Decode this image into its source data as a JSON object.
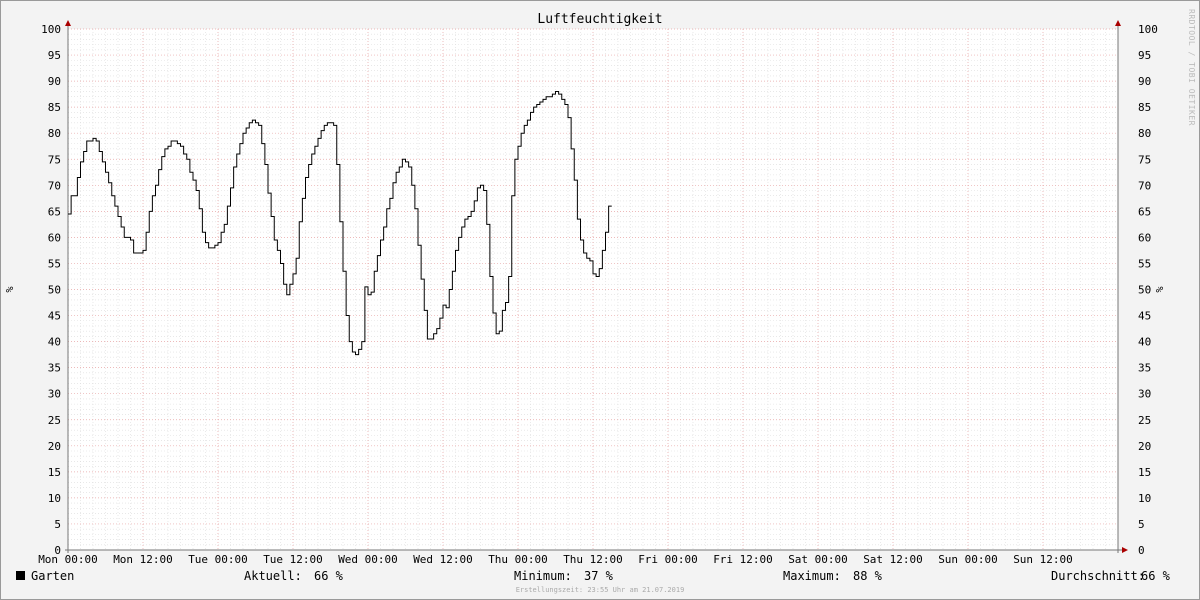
{
  "chart_data": {
    "type": "line",
    "title": "Luftfeuchtigkeit",
    "ylabel": "%",
    "ylim": [
      0,
      100
    ],
    "yticks": [
      0,
      5,
      10,
      15,
      20,
      25,
      30,
      35,
      40,
      45,
      50,
      55,
      60,
      65,
      70,
      75,
      80,
      85,
      90,
      95,
      100
    ],
    "x_ticks": [
      {
        "hour": 0,
        "label": "Mon 00:00"
      },
      {
        "hour": 12,
        "label": "Mon 12:00"
      },
      {
        "hour": 24,
        "label": "Tue 00:00"
      },
      {
        "hour": 36,
        "label": "Tue 12:00"
      },
      {
        "hour": 48,
        "label": "Wed 00:00"
      },
      {
        "hour": 60,
        "label": "Wed 12:00"
      },
      {
        "hour": 72,
        "label": "Thu 00:00"
      },
      {
        "hour": 84,
        "label": "Thu 12:00"
      },
      {
        "hour": 96,
        "label": "Fri 00:00"
      },
      {
        "hour": 108,
        "label": "Fri 12:00"
      },
      {
        "hour": 120,
        "label": "Sat 00:00"
      },
      {
        "hour": 132,
        "label": "Sat 12:00"
      },
      {
        "hour": 144,
        "label": "Sun 00:00"
      },
      {
        "hour": 156,
        "label": "Sun 12:00"
      }
    ],
    "xlim_hours": [
      0,
      168
    ],
    "grid": true,
    "series": [
      {
        "name": "Garten",
        "color": "#000000",
        "points": [
          [
            0,
            64.5
          ],
          [
            0.5,
            68
          ],
          [
            1.5,
            71.5
          ],
          [
            2,
            74.5
          ],
          [
            2.5,
            76.5
          ],
          [
            3,
            78.5
          ],
          [
            4,
            79
          ],
          [
            4.5,
            78.5
          ],
          [
            5,
            76.5
          ],
          [
            5.5,
            74.5
          ],
          [
            6,
            72.5
          ],
          [
            6.5,
            70.5
          ],
          [
            7,
            68
          ],
          [
            7.5,
            66
          ],
          [
            8,
            64
          ],
          [
            8.5,
            62
          ],
          [
            9,
            60
          ],
          [
            10,
            59.5
          ],
          [
            10.5,
            57
          ],
          [
            12,
            57.5
          ],
          [
            12.5,
            61
          ],
          [
            13,
            65
          ],
          [
            13.5,
            68
          ],
          [
            14,
            70
          ],
          [
            14.5,
            73
          ],
          [
            15,
            75.5
          ],
          [
            15.5,
            77
          ],
          [
            16,
            77.5
          ],
          [
            16.5,
            78.5
          ],
          [
            17.5,
            78
          ],
          [
            18,
            77.5
          ],
          [
            18.5,
            76
          ],
          [
            19,
            75
          ],
          [
            19.5,
            72.5
          ],
          [
            20,
            71
          ],
          [
            20.5,
            69
          ],
          [
            21,
            65.5
          ],
          [
            21.5,
            61
          ],
          [
            22,
            59
          ],
          [
            22.5,
            58
          ],
          [
            23.5,
            58.5
          ],
          [
            24,
            59
          ],
          [
            24.5,
            61
          ],
          [
            25,
            62.5
          ],
          [
            25.5,
            66
          ],
          [
            26,
            69.5
          ],
          [
            26.5,
            73.5
          ],
          [
            27,
            76
          ],
          [
            27.5,
            78
          ],
          [
            28,
            80
          ],
          [
            28.5,
            81
          ],
          [
            29,
            82
          ],
          [
            29.5,
            82.5
          ],
          [
            30,
            82
          ],
          [
            30.5,
            81.5
          ],
          [
            31,
            78
          ],
          [
            31.5,
            74
          ],
          [
            32,
            68.5
          ],
          [
            32.5,
            64
          ],
          [
            33,
            59.5
          ],
          [
            33.5,
            57.5
          ],
          [
            34,
            55
          ],
          [
            34.5,
            51
          ],
          [
            35,
            49
          ],
          [
            35.5,
            51
          ],
          [
            36,
            53
          ],
          [
            36.5,
            56
          ],
          [
            37,
            63
          ],
          [
            37.5,
            67.5
          ],
          [
            38,
            71.5
          ],
          [
            38.5,
            74
          ],
          [
            39,
            76
          ],
          [
            39.5,
            77.5
          ],
          [
            40,
            79
          ],
          [
            40.5,
            80.5
          ],
          [
            41,
            81.5
          ],
          [
            41.5,
            82
          ],
          [
            42.5,
            81.5
          ],
          [
            43,
            74
          ],
          [
            43.5,
            63
          ],
          [
            44,
            53.5
          ],
          [
            44.5,
            45
          ],
          [
            45,
            40
          ],
          [
            45.5,
            38
          ],
          [
            46,
            37.5
          ],
          [
            46.5,
            38.5
          ],
          [
            47,
            40
          ],
          [
            47.5,
            50.5
          ],
          [
            48,
            49
          ],
          [
            48.5,
            49.5
          ],
          [
            49,
            53.5
          ],
          [
            49.5,
            56.5
          ],
          [
            50,
            59.5
          ],
          [
            50.5,
            62
          ],
          [
            51,
            65.5
          ],
          [
            51.5,
            67.5
          ],
          [
            52,
            70.5
          ],
          [
            52.5,
            72.5
          ],
          [
            53,
            73.5
          ],
          [
            53.5,
            75
          ],
          [
            54,
            74.5
          ],
          [
            54.5,
            73.5
          ],
          [
            55,
            70
          ],
          [
            55.5,
            65.5
          ],
          [
            56,
            58.5
          ],
          [
            56.5,
            52
          ],
          [
            57,
            46
          ],
          [
            57.5,
            40.5
          ],
          [
            58.5,
            41.5
          ],
          [
            59,
            42.5
          ],
          [
            59.5,
            44.5
          ],
          [
            60,
            47
          ],
          [
            60.5,
            46.5
          ],
          [
            61,
            50
          ],
          [
            61.5,
            53.5
          ],
          [
            62,
            57.5
          ],
          [
            62.5,
            60
          ],
          [
            63,
            62
          ],
          [
            63.5,
            63.5
          ],
          [
            64,
            64
          ],
          [
            64.5,
            65
          ],
          [
            65,
            67
          ],
          [
            65.5,
            69.5
          ],
          [
            66,
            70
          ],
          [
            66.5,
            69
          ],
          [
            67,
            62.5
          ],
          [
            67.5,
            52.5
          ],
          [
            68,
            45.5
          ],
          [
            68.5,
            41.5
          ],
          [
            69,
            42
          ],
          [
            69.5,
            46
          ],
          [
            70,
            47.5
          ],
          [
            70.5,
            52.5
          ],
          [
            71,
            68
          ],
          [
            71.5,
            75
          ],
          [
            72,
            77.5
          ],
          [
            72.5,
            80
          ],
          [
            73,
            81.5
          ],
          [
            73.5,
            82.5
          ],
          [
            74,
            84
          ],
          [
            74.5,
            85
          ],
          [
            75,
            85.5
          ],
          [
            75.5,
            86
          ],
          [
            76,
            86.5
          ],
          [
            76.5,
            87
          ],
          [
            77.5,
            87.5
          ],
          [
            78,
            88
          ],
          [
            78.5,
            87.5
          ],
          [
            79,
            86.5
          ],
          [
            79.5,
            85.5
          ],
          [
            80,
            83
          ],
          [
            80.5,
            77
          ],
          [
            81,
            71
          ],
          [
            81.5,
            63.5
          ],
          [
            82,
            59.5
          ],
          [
            82.5,
            57
          ],
          [
            83,
            56
          ],
          [
            83.5,
            55.5
          ],
          [
            84,
            53
          ],
          [
            84.5,
            52.5
          ],
          [
            85,
            54
          ],
          [
            85.5,
            57.5
          ],
          [
            86,
            61
          ],
          [
            86.5,
            66
          ]
        ]
      }
    ],
    "legend": {
      "series_label": "Garten",
      "stats": [
        {
          "label": "Aktuell:",
          "value": "66 %"
        },
        {
          "label": "Minimum:",
          "value": "37 %"
        },
        {
          "label": "Maximum:",
          "value": "88 %"
        },
        {
          "label": "Durchschnitt:",
          "value": "66 %"
        }
      ]
    },
    "watermark": "RRDTOOL / TOBI OETIKER",
    "footer": "Erstellungszeit: 23:55 Uhr am 21.07.2019"
  }
}
